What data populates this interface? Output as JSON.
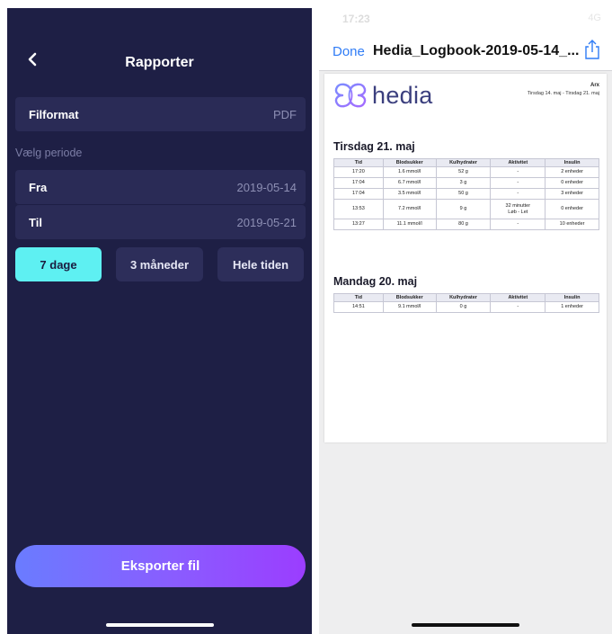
{
  "left_screen": {
    "title": "Rapporter",
    "file_format": {
      "label": "Filformat",
      "value": "PDF"
    },
    "period_section_label": "Vælg periode",
    "from": {
      "label": "Fra",
      "value": "2019-05-14"
    },
    "to": {
      "label": "Til",
      "value": "2019-05-21"
    },
    "presets": [
      {
        "label": "7 dage",
        "selected": true
      },
      {
        "label": "3 måneder",
        "selected": false
      },
      {
        "label": "Hele tiden",
        "selected": false
      }
    ],
    "export_label": "Eksporter fil",
    "colors": {
      "background": "#1e1f45",
      "row": "#2a2b56",
      "accent": "#5ef0f2",
      "export_gradient": [
        "#6a7cff",
        "#9b3dff"
      ]
    }
  },
  "right_screen": {
    "status_time": "17:23",
    "status_network": "4G",
    "done_label": "Done",
    "file_name": "Hedia_Logbook-2019-05-14_...",
    "share_icon": "share-icon",
    "document": {
      "logo_text": "hedia",
      "user": "Arx",
      "date_range": "Tirsdag 14. maj - Tirsdag 21. maj",
      "columns": [
        "Tid",
        "Blodsukker",
        "Kulhydrater",
        "Aktivitet",
        "Insulin"
      ],
      "days": [
        {
          "title": "Tirsdag 21. maj",
          "rows": [
            {
              "time": "17:20",
              "glucose": "1.6 mmol/l",
              "carbs": "52 g",
              "activity_line1": "-",
              "activity_line2": "",
              "insulin": "2 enheder"
            },
            {
              "time": "17:04",
              "glucose": "6.7 mmol/l",
              "carbs": "3 g",
              "activity_line1": "-",
              "activity_line2": "",
              "insulin": "0 enheder"
            },
            {
              "time": "17:04",
              "glucose": "3.5 mmol/l",
              "carbs": "50 g",
              "activity_line1": "-",
              "activity_line2": "",
              "insulin": "3 enheder"
            },
            {
              "time": "13:53",
              "glucose": "7.2 mmol/l",
              "carbs": "9 g",
              "activity_line1": "32 minutter",
              "activity_line2": "Løb - Let",
              "insulin": "0 enheder"
            },
            {
              "time": "13:27",
              "glucose": "11.1 mmol/l",
              "carbs": "80 g",
              "activity_line1": "-",
              "activity_line2": "",
              "insulin": "10 enheder"
            }
          ]
        },
        {
          "title": "Mandag 20. maj",
          "rows": [
            {
              "time": "14:51",
              "glucose": "9.1 mmol/l",
              "carbs": "0 g",
              "activity_line1": "-",
              "activity_line2": "",
              "insulin": "1 enheder"
            }
          ]
        }
      ]
    }
  }
}
